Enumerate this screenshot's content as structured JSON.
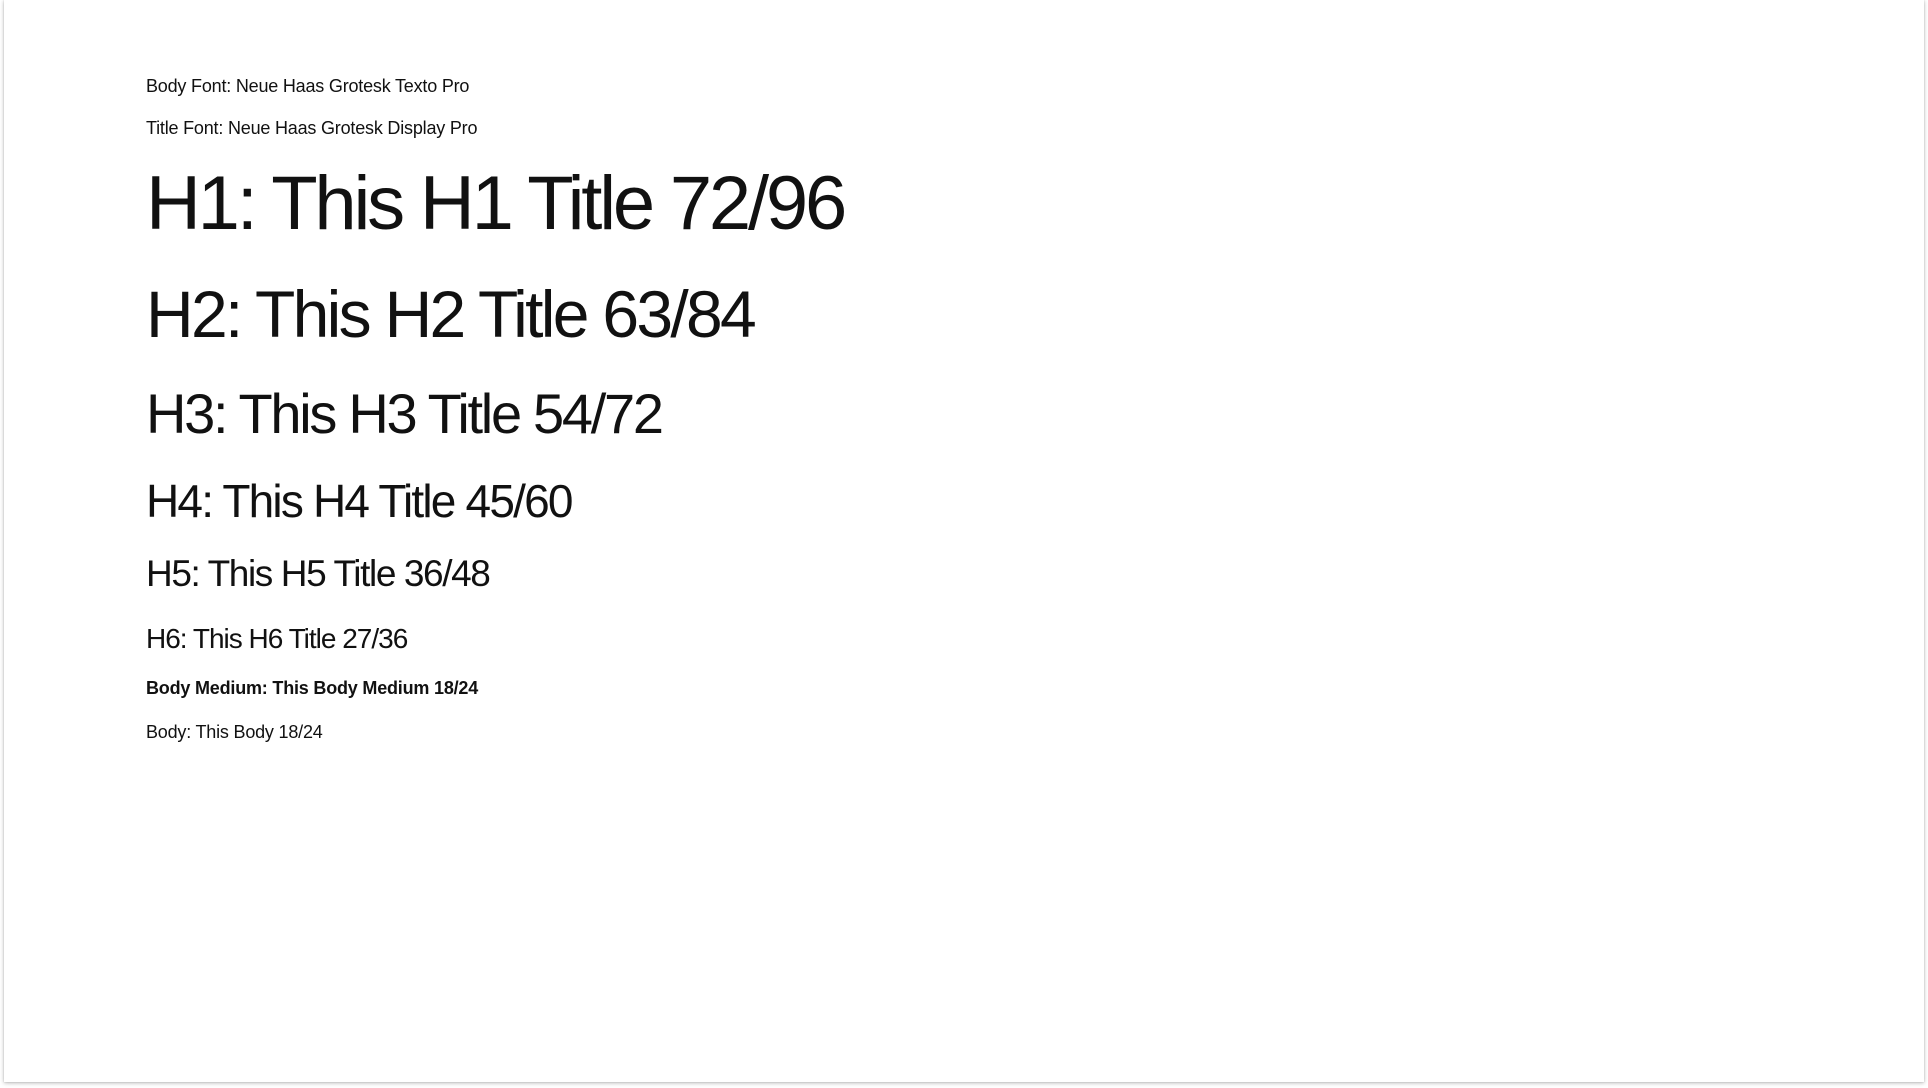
{
  "fonts": {
    "body_label": "Body Font: Neue Haas Grotesk Texto Pro",
    "title_label": "Title Font: Neue Haas Grotesk Display Pro"
  },
  "samples": {
    "h1": "H1: This H1 Title 72/96",
    "h2": "H2: This H2 Title 63/84",
    "h3": "H3: This H3 Title 54/72",
    "h4": "H4: This H4 Title 45/60",
    "h5": "H5: This H5 Title 36/48",
    "h6": "H6: This H6 Title 27/36",
    "body_medium": "Body Medium: This Body Medium 18/24",
    "body": "Body: This Body 18/24"
  }
}
